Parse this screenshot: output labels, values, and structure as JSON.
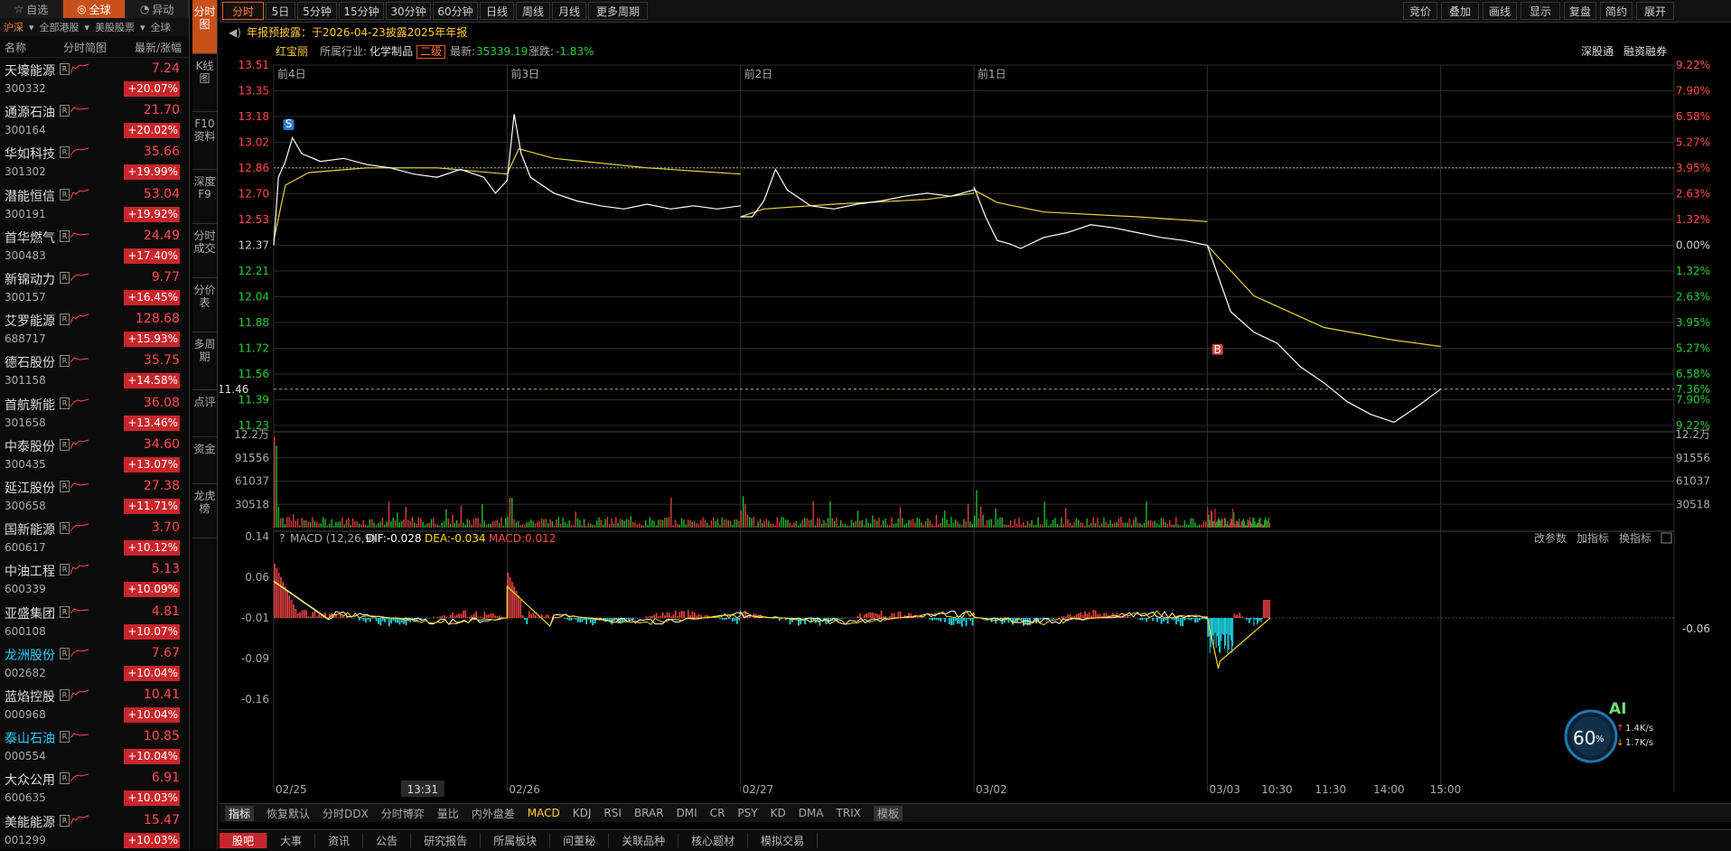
{
  "left_panel": {
    "tabs": [
      {
        "label": "自选",
        "icon": "star-icon"
      },
      {
        "label": "全球",
        "icon": "globe-icon",
        "active": true
      },
      {
        "label": "异动",
        "icon": "bell-icon"
      }
    ],
    "sub_filters": [
      "沪深",
      "全部港股",
      "美股股票",
      "全球"
    ],
    "header": {
      "name": "名称",
      "chart": "分时简图",
      "price": "最新/涨幅"
    },
    "stocks": [
      {
        "name": "天壕能源",
        "code": "300332",
        "price": "7.24",
        "change": "+20.07%"
      },
      {
        "name": "通源石油",
        "code": "300164",
        "price": "21.70",
        "change": "+20.02%"
      },
      {
        "name": "华如科技",
        "code": "301302",
        "price": "35.66",
        "change": "+19.99%"
      },
      {
        "name": "潜能恒信",
        "code": "300191",
        "price": "53.04",
        "change": "+19.92%"
      },
      {
        "name": "首华燃气",
        "code": "300483",
        "price": "24.49",
        "change": "+17.40%"
      },
      {
        "name": "新锦动力",
        "code": "300157",
        "price": "9.77",
        "change": "+16.45%"
      },
      {
        "name": "艾罗能源",
        "code": "688717",
        "price": "128.68",
        "change": "+15.93%"
      },
      {
        "name": "德石股份",
        "code": "301158",
        "price": "35.75",
        "change": "+14.58%"
      },
      {
        "name": "首航新能",
        "code": "301658",
        "price": "36.08",
        "change": "+13.46%"
      },
      {
        "name": "中泰股份",
        "code": "300435",
        "price": "34.60",
        "change": "+13.07%"
      },
      {
        "name": "延江股份",
        "code": "300658",
        "price": "27.38",
        "change": "+11.71%"
      },
      {
        "name": "国新能源",
        "code": "600617",
        "price": "3.70",
        "change": "+10.12%"
      },
      {
        "name": "中油工程",
        "code": "600339",
        "price": "5.13",
        "change": "+10.09%"
      },
      {
        "name": "亚盛集团",
        "code": "600108",
        "price": "4.81",
        "change": "+10.07%"
      },
      {
        "name": "龙洲股份",
        "code": "002682",
        "price": "7.67",
        "change": "+10.04%"
      },
      {
        "name": "蓝焰控股",
        "code": "000968",
        "price": "10.41",
        "change": "+10.04%"
      },
      {
        "name": "泰山石油",
        "code": "000554",
        "price": "10.85",
        "change": "+10.04%"
      },
      {
        "name": "大众公用",
        "code": "600635",
        "price": "6.91",
        "change": "+10.03%"
      },
      {
        "name": "美能能源",
        "code": "001299",
        "price": "15.47",
        "change": "+10.03%"
      }
    ]
  },
  "vertical_tabs": [
    "分时图",
    "K线图",
    "F10资料",
    "深度F9",
    "分时成交",
    "分价表",
    "多周期",
    "点评",
    "资金",
    "龙虎榜"
  ],
  "toolbar": {
    "periods": [
      "分时",
      "5日",
      "5分钟",
      "15分钟",
      "30分钟",
      "60分钟",
      "日线",
      "周线",
      "月线",
      "更多周期"
    ],
    "right": [
      "竞价",
      "叠加",
      "画线",
      "显示",
      "复盘",
      "简约",
      "展开"
    ]
  },
  "info": {
    "notice": "年报预披露：于2026-04-23披露2025年年报",
    "stock_name": "红宝丽",
    "industry_label": "所属行业:",
    "industry": "化学制品",
    "level": "二级",
    "latest_label": "最新:",
    "latest": "35339.19",
    "change_label": "涨跌:",
    "change": "-1.83%",
    "right_links": [
      "深股通",
      "融资融券"
    ]
  },
  "chart_data": {
    "type": "line",
    "price_axis": [
      "13.51",
      "13.35",
      "13.18",
      "13.02",
      "12.86",
      "12.70",
      "12.53",
      "12.37",
      "12.21",
      "12.04",
      "11.88",
      "11.72",
      "11.56",
      "11.39",
      "11.23"
    ],
    "pct_axis": [
      "9.22%",
      "7.90%",
      "6.58%",
      "5.27%",
      "3.95%",
      "2.63%",
      "1.32%",
      "0.00%",
      "1.32%",
      "2.63%",
      "3.95%",
      "5.27%",
      "6.58%",
      "7.90%",
      "9.22%"
    ],
    "ylim": [
      11.23,
      13.51
    ],
    "day_labels": [
      "前4日",
      "前3日",
      "前2日",
      "前1日"
    ],
    "current_price_label": "11.46",
    "current_pct_label": "7.36%",
    "markers": [
      "S",
      "B"
    ],
    "volume_axis": [
      "12.2万",
      "91556",
      "61037",
      "30518"
    ],
    "volume_unit_right": "12.2万",
    "macd": {
      "label": "MACD (12,26,9)",
      "dif": "DIF:-0.028",
      "dea": "DEA:-0.034",
      "macd": "MACD:0.012",
      "axis": [
        "0.14",
        "0.06",
        "-0.01",
        "-0.09",
        "-0.16"
      ],
      "right_value": "-0.06"
    },
    "macd_tools": [
      "改参数",
      "加指标",
      "换指标"
    ],
    "x_labels": [
      "02/25",
      "02/26",
      "02/27",
      "03/02",
      "03/03",
      "10:30",
      "11:30",
      "14:00",
      "15:00"
    ],
    "cursor_time": "13:31",
    "day_price_points": [
      [
        [
          0,
          12.37
        ],
        [
          0.02,
          12.8
        ],
        [
          0.05,
          12.9
        ],
        [
          0.08,
          13.05
        ],
        [
          0.12,
          12.95
        ],
        [
          0.2,
          12.9
        ],
        [
          0.3,
          12.92
        ],
        [
          0.4,
          12.88
        ],
        [
          0.5,
          12.86
        ],
        [
          0.6,
          12.82
        ],
        [
          0.7,
          12.8
        ],
        [
          0.8,
          12.85
        ],
        [
          0.9,
          12.8
        ],
        [
          0.95,
          12.7
        ],
        [
          1,
          12.78
        ]
      ],
      [
        [
          0,
          12.78
        ],
        [
          0.03,
          13.2
        ],
        [
          0.06,
          12.95
        ],
        [
          0.1,
          12.8
        ],
        [
          0.2,
          12.7
        ],
        [
          0.3,
          12.65
        ],
        [
          0.4,
          12.62
        ],
        [
          0.5,
          12.6
        ],
        [
          0.6,
          12.63
        ],
        [
          0.7,
          12.6
        ],
        [
          0.8,
          12.62
        ],
        [
          0.9,
          12.6
        ],
        [
          1,
          12.62
        ]
      ],
      [
        [
          0,
          12.55
        ],
        [
          0.05,
          12.55
        ],
        [
          0.1,
          12.65
        ],
        [
          0.15,
          12.85
        ],
        [
          0.2,
          12.72
        ],
        [
          0.3,
          12.62
        ],
        [
          0.4,
          12.6
        ],
        [
          0.5,
          12.63
        ],
        [
          0.6,
          12.65
        ],
        [
          0.7,
          12.68
        ],
        [
          0.8,
          12.7
        ],
        [
          0.9,
          12.68
        ],
        [
          1,
          12.72
        ]
      ],
      [
        [
          0,
          12.74
        ],
        [
          0.05,
          12.55
        ],
        [
          0.1,
          12.4
        ],
        [
          0.15,
          12.38
        ],
        [
          0.2,
          12.35
        ],
        [
          0.3,
          12.42
        ],
        [
          0.4,
          12.45
        ],
        [
          0.5,
          12.5
        ],
        [
          0.6,
          12.48
        ],
        [
          0.7,
          12.45
        ],
        [
          0.8,
          12.42
        ],
        [
          0.9,
          12.4
        ],
        [
          1,
          12.37
        ]
      ],
      [
        [
          0,
          12.37
        ],
        [
          0.1,
          11.95
        ],
        [
          0.2,
          11.82
        ],
        [
          0.3,
          11.75
        ],
        [
          0.4,
          11.6
        ],
        [
          0.5,
          11.5
        ],
        [
          0.6,
          11.38
        ],
        [
          0.7,
          11.3
        ],
        [
          0.8,
          11.25
        ],
        [
          0.9,
          11.35
        ],
        [
          1,
          11.46
        ]
      ]
    ],
    "day_avg_points": [
      [
        [
          0,
          12.4
        ],
        [
          0.05,
          12.75
        ],
        [
          0.15,
          12.83
        ],
        [
          0.4,
          12.86
        ],
        [
          0.7,
          12.86
        ],
        [
          1,
          12.82
        ]
      ],
      [
        [
          0,
          12.82
        ],
        [
          0.05,
          12.98
        ],
        [
          0.2,
          12.92
        ],
        [
          0.6,
          12.86
        ],
        [
          1,
          12.82
        ]
      ],
      [
        [
          0,
          12.55
        ],
        [
          0.1,
          12.6
        ],
        [
          0.4,
          12.63
        ],
        [
          0.8,
          12.66
        ],
        [
          1,
          12.7
        ]
      ],
      [
        [
          0,
          12.72
        ],
        [
          0.1,
          12.64
        ],
        [
          0.3,
          12.58
        ],
        [
          0.7,
          12.55
        ],
        [
          1,
          12.52
        ]
      ],
      [
        [
          0,
          12.37
        ],
        [
          0.2,
          12.05
        ],
        [
          0.5,
          11.85
        ],
        [
          0.8,
          11.77
        ],
        [
          1,
          11.73
        ]
      ]
    ]
  },
  "indicator_tabs": [
    "指标",
    "恢复默认",
    "分时DDX",
    "分时博弈",
    "量比",
    "内外盘差",
    "MACD",
    "KDJ",
    "RSI",
    "BRAR",
    "DMI",
    "CR",
    "PSY",
    "KD",
    "DMA",
    "TRIX",
    "模板"
  ],
  "bottom_tabs": [
    "股吧",
    "大事",
    "资讯",
    "公告",
    "研究报告",
    "所属板块",
    "问董秘",
    "关联品种",
    "核心题材",
    "模拟交易"
  ],
  "ai_widget": {
    "label": "AI",
    "percent": "60",
    "unit": "%",
    "up": "1.4K/s",
    "down": "1.7K/s"
  }
}
